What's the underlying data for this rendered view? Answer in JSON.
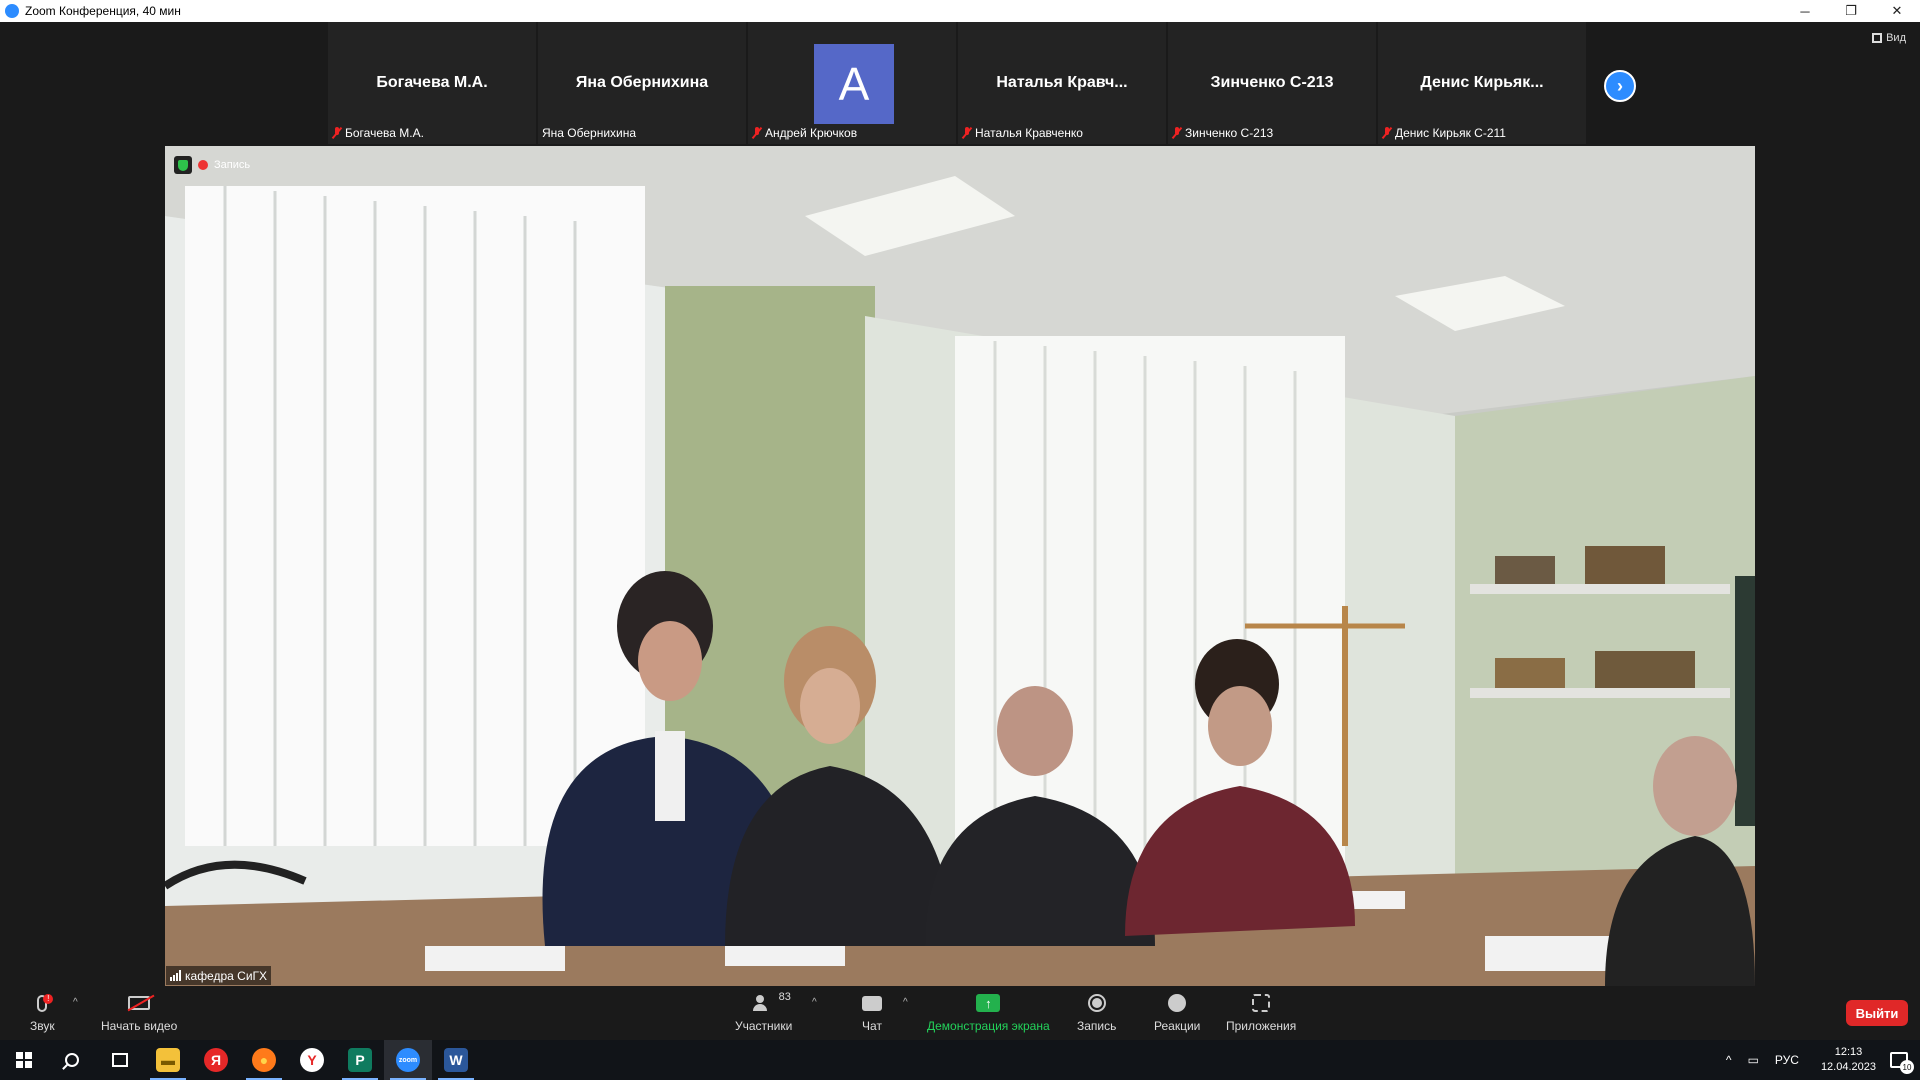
{
  "window": {
    "title": "Zoom Конференция, 40 мин",
    "controls": {
      "minimize": "─",
      "restore": "❐",
      "close": "✕"
    }
  },
  "view_button": {
    "label": "Вид",
    "icon": "grid-icon"
  },
  "thumbnails": [
    {
      "big_name": "Богачева М.А.",
      "label": "Богачева М.А.",
      "muted": true
    },
    {
      "big_name": "Яна Обернихина",
      "label": "Яна Обернихина",
      "muted": false
    },
    {
      "big_name": "",
      "avatar_letter": "А",
      "label": "Андрей Крючков",
      "muted": true
    },
    {
      "big_name": "Наталья Кравч...",
      "label": "Наталья Кравченко",
      "muted": true
    },
    {
      "big_name": "Зинченко С-213",
      "label": "Зинченко С-213",
      "muted": true
    },
    {
      "big_name": "Денис Кирьяк...",
      "label": "Денис Кирьяк С-211",
      "muted": true
    }
  ],
  "next_page_icon": "chevron-right-icon",
  "main_video": {
    "participant": "кафедра СиГХ",
    "recording_label": "Запись"
  },
  "toolbar": {
    "audio": {
      "label": "Звук",
      "icon": "mic-icon",
      "alert": "!"
    },
    "video": {
      "label": "Начать видео",
      "icon": "camera-off-icon"
    },
    "participants": {
      "label": "Участники",
      "count": "83",
      "icon": "people-icon"
    },
    "chat": {
      "label": "Чат",
      "icon": "chat-icon"
    },
    "share": {
      "label": "Демонстрация экрана",
      "icon": "share-arrow-icon",
      "color": "#23b14d"
    },
    "record": {
      "label": "Запись",
      "icon": "record-icon"
    },
    "reactions": {
      "label": "Реакции",
      "icon": "emoji-icon"
    },
    "apps": {
      "label": "Приложения",
      "icon": "apps-icon"
    },
    "leave": {
      "label": "Выйти",
      "color": "#e02828"
    },
    "caret": "^"
  },
  "taskbar": {
    "apps": [
      {
        "name": "explorer",
        "glyph": "▬",
        "color": "#f3c13a"
      },
      {
        "name": "yandex",
        "glyph": "Я",
        "color": "#e62828"
      },
      {
        "name": "firefox",
        "glyph": "●",
        "color": "#ff7a1a"
      },
      {
        "name": "yandex-browser",
        "glyph": "Y",
        "color": "#e62828"
      },
      {
        "name": "publisher",
        "glyph": "P",
        "color": "#0f7b5f"
      },
      {
        "name": "zoom",
        "glyph": "zoom",
        "color": "#2d8cff"
      },
      {
        "name": "word",
        "glyph": "W",
        "color": "#2b579a"
      }
    ],
    "tray": {
      "language": "РУС",
      "time": "12:13",
      "date": "12.04.2023",
      "notifications": "10",
      "chevron": "^"
    }
  }
}
